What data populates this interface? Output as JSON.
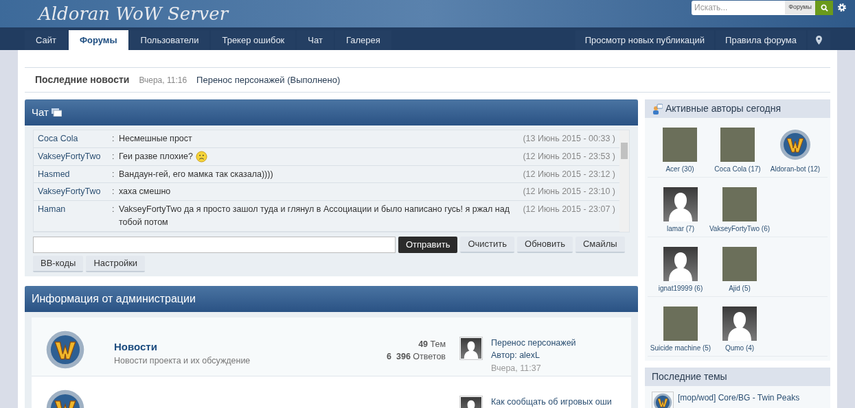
{
  "logo": "Aldoran WoW Server",
  "search": {
    "placeholder": "Искать...",
    "scope": "Форумы"
  },
  "nav_left": [
    {
      "label": "Сайт",
      "selected": false
    },
    {
      "label": "Форумы",
      "selected": true
    },
    {
      "label": "Пользователи",
      "selected": false
    },
    {
      "label": "Трекер ошибок",
      "selected": false
    },
    {
      "label": "Чат",
      "selected": false
    },
    {
      "label": "Галерея",
      "selected": false
    }
  ],
  "nav_right": [
    "Просмотр новых публикаций",
    "Правила форума"
  ],
  "news_ticker": {
    "title": "Последние новости",
    "time": "Вчера, 11:16",
    "text": "Перенос персонажей (Выполнено)"
  },
  "chat": {
    "title": "Чат",
    "messages": [
      {
        "author": "Coca Cola",
        "separator": ":",
        "text": "Несмешные прост",
        "time": "(13 Июнь 2015 - 00:33 )",
        "emoticon": false
      },
      {
        "author": "VakseyFortyTwo",
        "separator": ":",
        "text": "Геи разве плохие?",
        "time": "(12 Июнь 2015 - 23:53 )",
        "emoticon": true
      },
      {
        "author": "Hasmed",
        "separator": ":",
        "text": "Вандаун-гей, его мамка так сказала))))",
        "time": "(12 Июнь 2015 - 23:12 )",
        "emoticon": false
      },
      {
        "author": "VakseyFortyTwo",
        "separator": ":",
        "text": "хаха смешно",
        "time": "(12 Июнь 2015 - 23:10 )",
        "emoticon": false
      },
      {
        "author": "Haman",
        "separator": ":",
        "text": "VakseyFortyTwo да я просто зашол туда и глянул в Ассоциации и было написано гусь! я ржал над тобой потом",
        "time": "(12 Июнь 2015 - 23:07 )",
        "emoticon": false
      }
    ],
    "send": "Отправить",
    "buttons": [
      "Очистить",
      "Обновить",
      "Смайлы",
      "BB-коды",
      "Настройки"
    ]
  },
  "admin": {
    "title": "Информация от администрации",
    "forums": [
      {
        "name": "Новости",
        "description": "Новости проекта и их обсуждение",
        "topics_count": "49",
        "topics_label": "Тем",
        "replies_count": "6  396",
        "replies_label": "Ответов",
        "last_title": "Перенос персонажей",
        "last_author": "Автор: alexL",
        "last_time": "Вчера, 11:37"
      },
      {
        "last_title": "Как сообщать об игровых оши"
      }
    ]
  },
  "active_authors": {
    "title": "Активные авторы сегодня",
    "rows": [
      [
        {
          "name": "Acer (30)",
          "kind": "photo"
        },
        {
          "name": "Coca Cola (17)",
          "kind": "photo"
        },
        {
          "name": "Aldoran-bot (12)",
          "kind": "emblem"
        }
      ],
      [
        {
          "name": "lamar (7)",
          "kind": "silhouette"
        },
        {
          "name": "VakseyFortyTwo (6)",
          "kind": "photo"
        }
      ],
      [
        {
          "name": "ignat19999 (6)",
          "kind": "silhouette"
        },
        {
          "name": "Ajid (5)",
          "kind": "photo"
        }
      ],
      [
        {
          "name": "Suicide machine (5)",
          "kind": "photo"
        },
        {
          "name": "Qumo (4)",
          "kind": "silhouette"
        }
      ]
    ]
  },
  "latest_topics": {
    "title": "Последние темы",
    "items": [
      "[mop/wod] Core/BG - Twin Peaks"
    ]
  }
}
